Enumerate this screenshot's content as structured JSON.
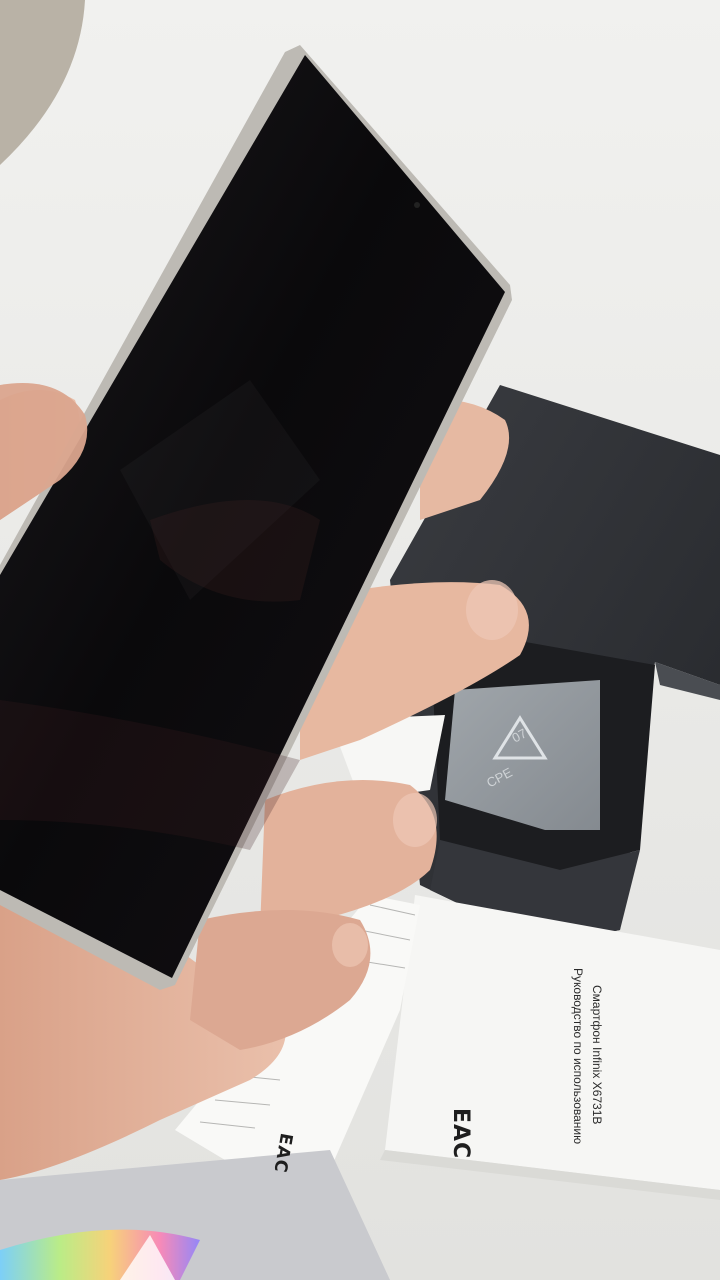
{
  "scene": {
    "description_tags": [
      "hand",
      "smartphone",
      "phone-box",
      "manual-booklet",
      "warranty-card",
      "holographic-sticker"
    ],
    "colors": {
      "background": "#e9e9e7",
      "phone_screen": "#0d0c0e",
      "phone_frame": "#b8b6b1",
      "box": "#2b2d31",
      "skin": "#e3b49c",
      "paper": "#f4f4f2"
    }
  },
  "booklet": {
    "title": "Смартфон Infinix X6731B",
    "subtitle": "Руководство по использованию",
    "mark": "EAC"
  },
  "card": {
    "mark": "EAC"
  },
  "insert": {
    "recycle_top": "07",
    "recycle_bottom": "CPE"
  }
}
